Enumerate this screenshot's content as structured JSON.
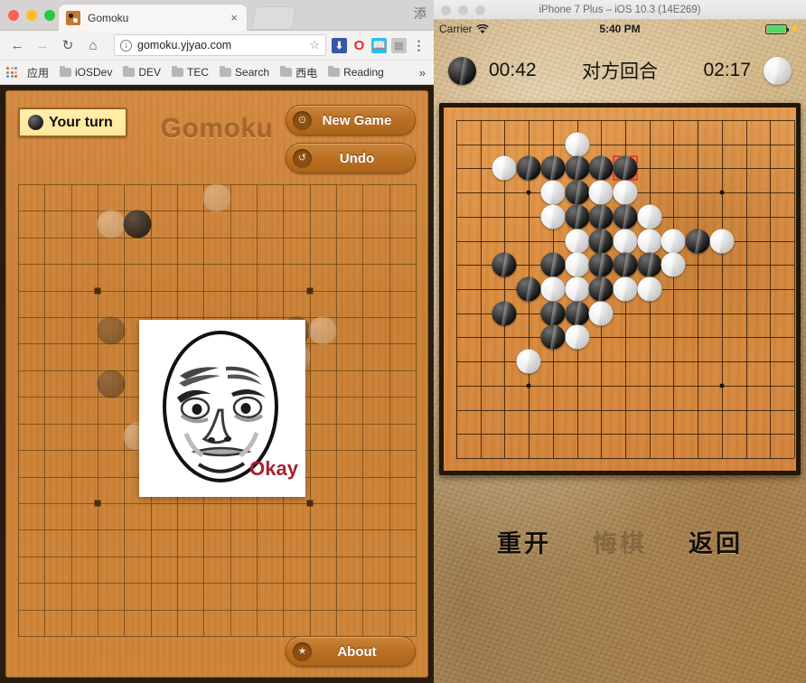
{
  "browser": {
    "window_controls": [
      "close",
      "minimize",
      "maximize"
    ],
    "tab": {
      "title": "Gomoku",
      "close_label": "×",
      "favicon": "gomoku-favicon"
    },
    "corner_glyph": "添",
    "toolbar": {
      "back": "←",
      "forward": "→",
      "reload": "↻",
      "home": "⌂",
      "info_icon": "i",
      "url": "gomoku.yjyao.com",
      "star": "☆",
      "extensions": [
        {
          "name": "download-extension-icon",
          "glyph": "⬇"
        },
        {
          "name": "opera-extension-icon",
          "glyph": "O"
        },
        {
          "name": "reader-extension-icon",
          "glyph": "📖"
        },
        {
          "name": "disabled-extension-icon",
          "glyph": "▤"
        }
      ],
      "menu": "⋮"
    },
    "bookmarks": {
      "apps_label": "应用",
      "items": [
        "iOSDev",
        "DEV",
        "TEC",
        "Search",
        "西电",
        "Reading"
      ],
      "overflow": "»"
    }
  },
  "web_app": {
    "title": "Gomoku",
    "turn_badge": "Your turn",
    "turn_stone_color": "black",
    "buttons": {
      "new_game": {
        "label": "New Game",
        "icon": "grid-icon",
        "glyph": "⊙"
      },
      "undo": {
        "label": "Undo",
        "icon": "undo-arrow-icon",
        "glyph": "↺"
      },
      "about": {
        "label": "About",
        "icon": "star-icon",
        "glyph": "★"
      }
    },
    "board": {
      "cols": 15,
      "rows": 17,
      "cell": 31,
      "star_points": [
        [
          3,
          4
        ],
        [
          11,
          4
        ],
        [
          3,
          12
        ],
        [
          11,
          12
        ]
      ],
      "stones": [
        {
          "c": 3,
          "r": 1,
          "color": "white",
          "opacity": 0.42
        },
        {
          "c": 4,
          "r": 1,
          "color": "black",
          "opacity": 0.95
        },
        {
          "c": 3,
          "r": 5,
          "color": "black",
          "opacity": 0.4
        },
        {
          "c": 7,
          "r": 0,
          "color": "white",
          "opacity": 0.35
        },
        {
          "c": 10,
          "r": 5,
          "color": "black",
          "opacity": 0.42
        },
        {
          "c": 11,
          "r": 5,
          "color": "white",
          "opacity": 0.38
        },
        {
          "c": 10,
          "r": 6,
          "color": "white",
          "opacity": 0.35
        },
        {
          "c": 5,
          "r": 6,
          "color": "black",
          "opacity": 0.4
        },
        {
          "c": 3,
          "r": 7,
          "color": "black",
          "opacity": 0.45
        },
        {
          "c": 5,
          "r": 7,
          "color": "black",
          "opacity": 0.45
        },
        {
          "c": 6,
          "r": 7,
          "color": "black",
          "opacity": 0.45
        },
        {
          "c": 7,
          "r": 7,
          "color": "white",
          "opacity": 0.35
        },
        {
          "c": 5,
          "r": 8,
          "color": "black",
          "opacity": 0.45
        },
        {
          "c": 6,
          "r": 8,
          "color": "white",
          "opacity": 0.35
        },
        {
          "c": 4,
          "r": 9,
          "color": "white",
          "opacity": 0.38
        },
        {
          "c": 6,
          "r": 6,
          "color": "white",
          "opacity": 0.3
        },
        {
          "c": 8,
          "r": 6,
          "color": "white",
          "opacity": 0.3
        },
        {
          "c": 9,
          "r": 6,
          "color": "white",
          "opacity": 0.3
        }
      ]
    },
    "meme": {
      "name": "okay-guy-meme",
      "caption": "Okay"
    }
  },
  "simulator": {
    "title": "iPhone 7 Plus – iOS 10.3 (14E269)",
    "status_bar": {
      "carrier": "Carrier",
      "wifi_icon": "wifi-icon",
      "time": "5:40 PM",
      "battery_level": 100,
      "battery_color": "#4cd964",
      "charging_glyph": "⚡"
    },
    "game_bar": {
      "black_time": "00:42",
      "turn_text": "对方回合",
      "white_time": "02:17"
    },
    "board": {
      "cols": 15,
      "rows": 15,
      "star_points": [
        [
          3,
          3
        ],
        [
          11,
          3
        ],
        [
          3,
          11
        ],
        [
          11,
          11
        ],
        [
          7,
          7
        ]
      ],
      "last_move": {
        "c": 7,
        "r": 2
      },
      "stones": [
        {
          "c": 5,
          "r": 1,
          "color": "white"
        },
        {
          "c": 2,
          "r": 2,
          "color": "white"
        },
        {
          "c": 3,
          "r": 2,
          "color": "black"
        },
        {
          "c": 4,
          "r": 2,
          "color": "black"
        },
        {
          "c": 5,
          "r": 2,
          "color": "black"
        },
        {
          "c": 6,
          "r": 2,
          "color": "black"
        },
        {
          "c": 7,
          "r": 2,
          "color": "black"
        },
        {
          "c": 4,
          "r": 3,
          "color": "white"
        },
        {
          "c": 5,
          "r": 3,
          "color": "black"
        },
        {
          "c": 6,
          "r": 3,
          "color": "white"
        },
        {
          "c": 7,
          "r": 3,
          "color": "white"
        },
        {
          "c": 4,
          "r": 4,
          "color": "white"
        },
        {
          "c": 5,
          "r": 4,
          "color": "black"
        },
        {
          "c": 6,
          "r": 4,
          "color": "black"
        },
        {
          "c": 7,
          "r": 4,
          "color": "black"
        },
        {
          "c": 8,
          "r": 4,
          "color": "white"
        },
        {
          "c": 5,
          "r": 5,
          "color": "white"
        },
        {
          "c": 6,
          "r": 5,
          "color": "black"
        },
        {
          "c": 7,
          "r": 5,
          "color": "white"
        },
        {
          "c": 8,
          "r": 5,
          "color": "white"
        },
        {
          "c": 9,
          "r": 5,
          "color": "white"
        },
        {
          "c": 10,
          "r": 5,
          "color": "black"
        },
        {
          "c": 11,
          "r": 5,
          "color": "white"
        },
        {
          "c": 2,
          "r": 6,
          "color": "black"
        },
        {
          "c": 4,
          "r": 6,
          "color": "black"
        },
        {
          "c": 5,
          "r": 6,
          "color": "white"
        },
        {
          "c": 6,
          "r": 6,
          "color": "black"
        },
        {
          "c": 7,
          "r": 6,
          "color": "black"
        },
        {
          "c": 8,
          "r": 6,
          "color": "black"
        },
        {
          "c": 9,
          "r": 6,
          "color": "white"
        },
        {
          "c": 3,
          "r": 7,
          "color": "black"
        },
        {
          "c": 4,
          "r": 7,
          "color": "white"
        },
        {
          "c": 5,
          "r": 7,
          "color": "white"
        },
        {
          "c": 6,
          "r": 7,
          "color": "black"
        },
        {
          "c": 7,
          "r": 7,
          "color": "white"
        },
        {
          "c": 8,
          "r": 7,
          "color": "white"
        },
        {
          "c": 2,
          "r": 8,
          "color": "black"
        },
        {
          "c": 4,
          "r": 8,
          "color": "black"
        },
        {
          "c": 5,
          "r": 8,
          "color": "black"
        },
        {
          "c": 6,
          "r": 8,
          "color": "white"
        },
        {
          "c": 4,
          "r": 9,
          "color": "black"
        },
        {
          "c": 5,
          "r": 9,
          "color": "white"
        },
        {
          "c": 3,
          "r": 10,
          "color": "white"
        }
      ]
    },
    "actions": [
      {
        "label": "重开",
        "name": "restart-button",
        "disabled": false
      },
      {
        "label": "悔棋",
        "name": "undo-button",
        "disabled": true
      },
      {
        "label": "返回",
        "name": "back-button",
        "disabled": false
      }
    ]
  }
}
